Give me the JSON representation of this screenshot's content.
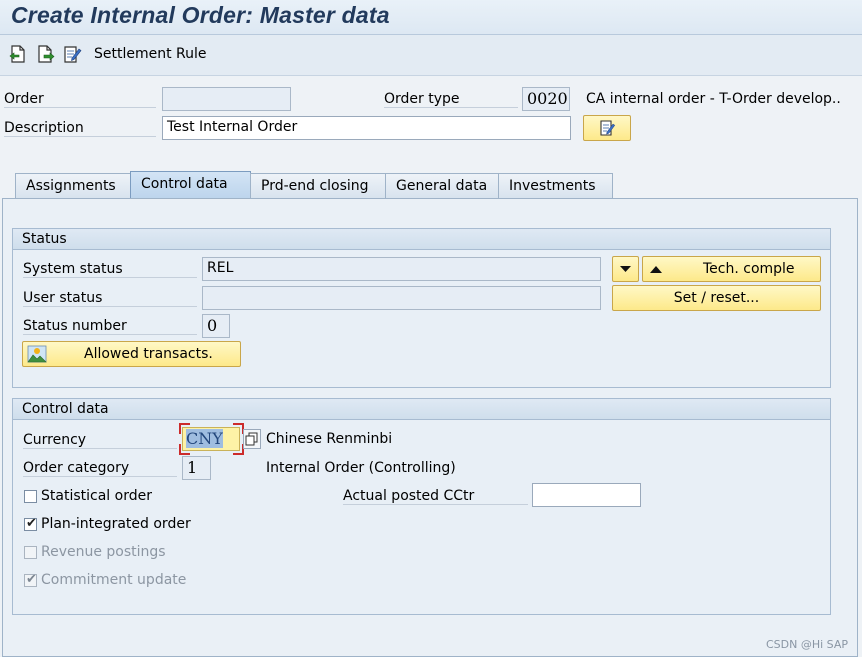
{
  "window": {
    "title": "Create Internal Order: Master data"
  },
  "toolbar": {
    "icons": [
      "new-doc-icon",
      "doc-arrow-icon",
      "edit-doc-icon"
    ],
    "settlement_rule_label": "Settlement Rule"
  },
  "header": {
    "order_label": "Order",
    "order_value": "",
    "order_type_label": "Order type",
    "order_type_value": "0020",
    "order_type_desc": "CA internal order - T-Order develop..",
    "description_label": "Description",
    "description_value": "Test Internal Order",
    "edit_button_icon": "edit-text-icon"
  },
  "tabs": [
    {
      "label": "Assignments",
      "active": false
    },
    {
      "label": "Control data",
      "active": true
    },
    {
      "label": "Prd-end closing",
      "active": false
    },
    {
      "label": "General data",
      "active": false
    },
    {
      "label": "Investments",
      "active": false
    }
  ],
  "status_group": {
    "title": "Status",
    "system_status_label": "System status",
    "system_status_value": "REL",
    "user_status_label": "User status",
    "user_status_value": "",
    "status_number_label": "Status number",
    "status_number_value": "0",
    "dropdown_icon": "triangle-down-icon",
    "tech_complete_label": "Tech. comple",
    "tech_complete_icon": "triangle-up-icon",
    "set_reset_label": "Set / reset...",
    "allowed_transacts_label": "Allowed transacts.",
    "allowed_transacts_icon": "landscape-icon"
  },
  "control_group": {
    "title": "Control data",
    "currency_label": "Currency",
    "currency_value": "CNY",
    "currency_desc": "Chinese Renminbi",
    "order_category_label": "Order category",
    "order_category_value": "1",
    "order_category_desc": "Internal Order (Controlling)",
    "statistical_order_label": "Statistical order",
    "statistical_order_checked": false,
    "actual_posted_label": "Actual posted CCtr",
    "actual_posted_value": "",
    "plan_integrated_label": "Plan-integrated order",
    "plan_integrated_checked": true,
    "revenue_postings_label": "Revenue postings",
    "revenue_postings_checked": false,
    "commitment_update_label": "Commitment update",
    "commitment_update_checked": true
  },
  "watermark": "CSDN @Hi SAP",
  "colors": {
    "title": "#223a5c",
    "button_yellow": "#fde98a",
    "focus_red": "#cc2b2b"
  }
}
